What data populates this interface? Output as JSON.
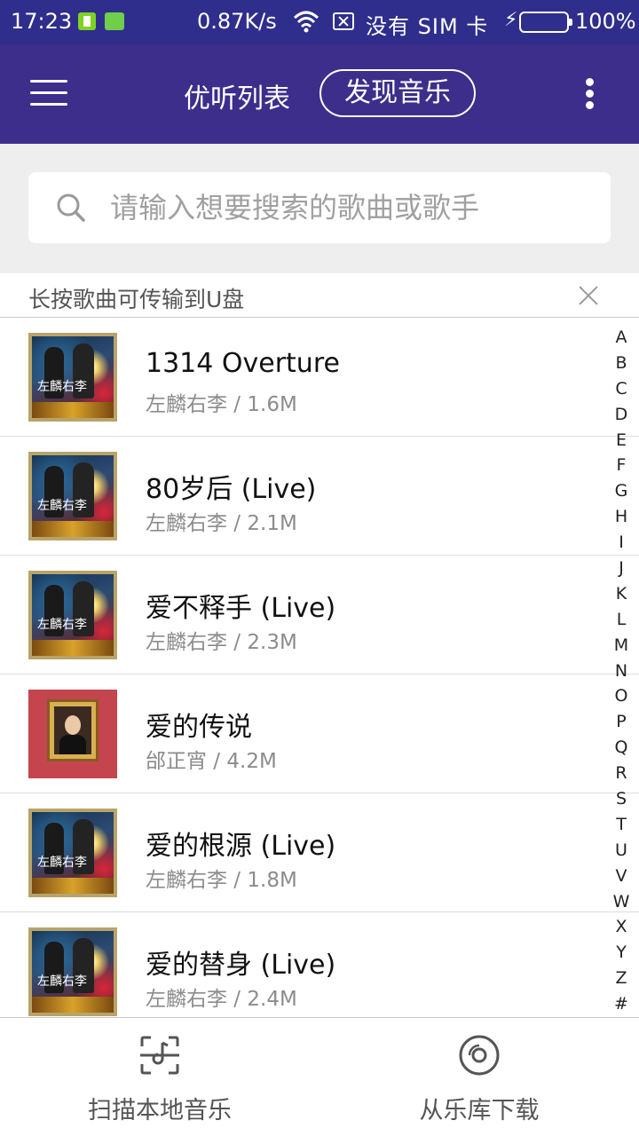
{
  "status_bar": {
    "time": "17:23",
    "speed": "0.87K/s",
    "carrier": "没有 SIM 卡",
    "battery": "100%"
  },
  "app_bar": {
    "tab_local": "优听列表",
    "tab_discover": "发现音乐"
  },
  "search": {
    "placeholder": "请输入想要搜索的歌曲或歌手",
    "value": ""
  },
  "hint": {
    "text": "长按歌曲可传输到U盘"
  },
  "songs": [
    {
      "title": "1314 Overture",
      "meta": "左麟右李 / 1.6M",
      "cover_text": "左麟右李"
    },
    {
      "title": "80岁后 (Live)",
      "meta": "左麟右李 / 2.1M",
      "cover_text": "左麟右李"
    },
    {
      "title": "爱不释手 (Live)",
      "meta": "左麟右李 / 2.3M",
      "cover_text": "左麟右李"
    },
    {
      "title": "爱的传说",
      "meta": "邰正宵 / 4.2M"
    },
    {
      "title": "爱的根源 (Live)",
      "meta": "左麟右李 / 1.8M",
      "cover_text": "左麟右李"
    },
    {
      "title": "爱的替身 (Live)",
      "meta": "左麟右李 / 2.4M",
      "cover_text": "左麟右李"
    }
  ],
  "alpha_index": [
    "A",
    "B",
    "C",
    "D",
    "E",
    "F",
    "G",
    "H",
    "I",
    "J",
    "K",
    "L",
    "M",
    "N",
    "O",
    "P",
    "Q",
    "R",
    "S",
    "T",
    "U",
    "V",
    "W",
    "X",
    "Y",
    "Z",
    "#"
  ],
  "bottom_bar": {
    "scan_label": "扫描本地音乐",
    "download_label": "从乐库下载"
  },
  "colors": {
    "status_bar": "#2f2e8c",
    "app_bar": "#3c2e8a",
    "search_area_bg": "#eeeeee",
    "battery_fill": "#3ddc3d"
  },
  "icons": {
    "menu": "hamburger-icon",
    "more": "more-vertical-icon",
    "search": "search-icon",
    "close": "close-icon",
    "scan": "scan-icon",
    "download": "disc-icon"
  }
}
